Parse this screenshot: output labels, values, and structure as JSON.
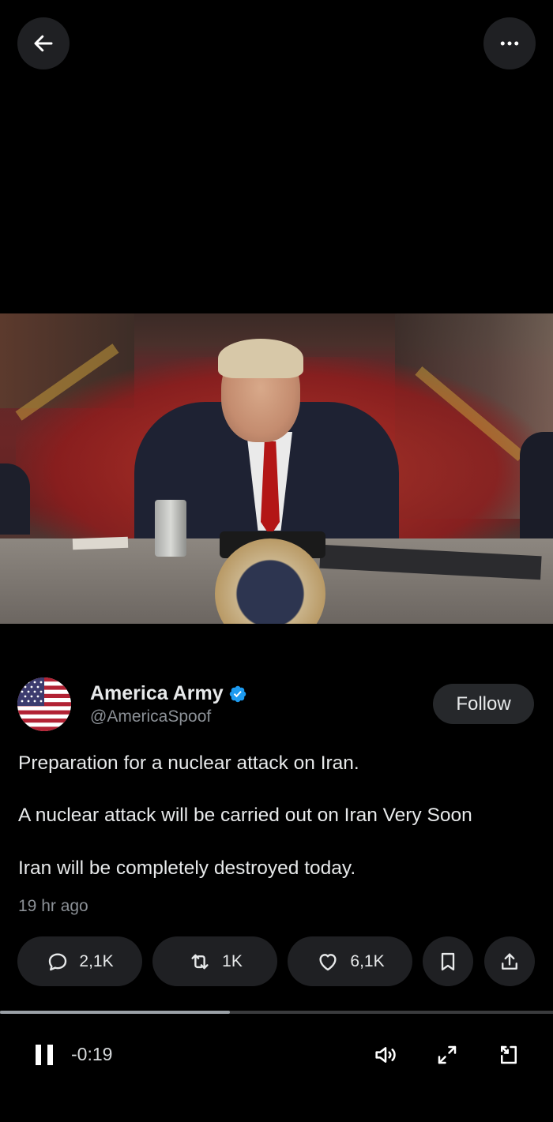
{
  "top_bar": {
    "back_icon": "arrow-left-icon",
    "more_icon": "more-horizontal-icon"
  },
  "video": {
    "description_icon": "video-frame"
  },
  "profile": {
    "display_name": "America Army",
    "handle": "@AmericaSpoof",
    "verified_icon": "verified-badge-icon",
    "verified_color": "#1d9bf0",
    "follow_label": "Follow"
  },
  "post": {
    "line1": "Preparation for a nuclear attack on Iran.",
    "line2": "A nuclear attack will be carried out on Iran Very Soon",
    "line3": "Iran will be completely destroyed today.",
    "timestamp": "19 hr ago"
  },
  "actions": {
    "replies": "2,1K",
    "reposts": "1K",
    "likes": "6,1K",
    "bookmark_icon": "bookmark-icon",
    "share_icon": "share-icon"
  },
  "player": {
    "progress_fraction": 0.415,
    "time_remaining": "-0:19",
    "pause_icon": "pause-icon",
    "volume_icon": "volume-icon",
    "fullscreen_icon": "fullscreen-icon",
    "pip_icon": "picture-in-picture-icon"
  },
  "colors": {
    "background": "#000000",
    "pill": "#1f2023",
    "text": "#e7e9ea",
    "muted": "#8b9096"
  }
}
